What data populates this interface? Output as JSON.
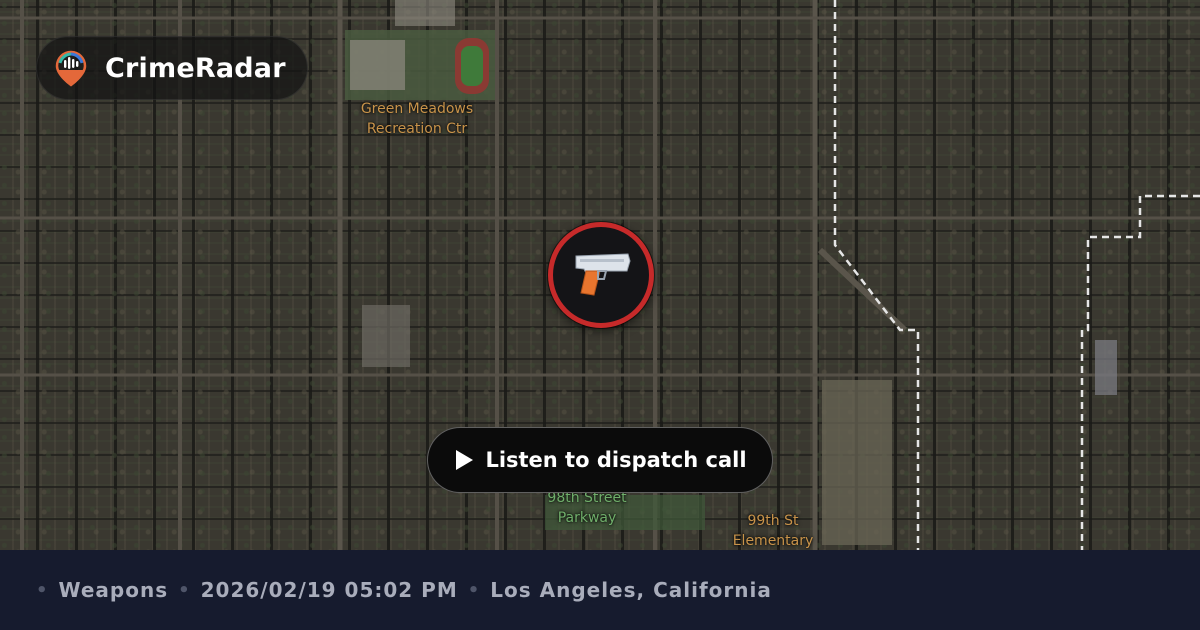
{
  "brand": {
    "name": "CrimeRadar",
    "logo_icon": "radar-pin-logo-icon"
  },
  "map": {
    "labels": [
      {
        "text": "Green Meadows\nRecreation Ctr",
        "color": "#c8934a"
      },
      {
        "text": "98th Street\nParkway",
        "color": "#6fae6a"
      },
      {
        "text": "99th St\nElementary",
        "color": "#c8934a"
      }
    ],
    "incident_marker": {
      "icon": "handgun-icon",
      "ring_color": "#c62a2a"
    }
  },
  "dispatch_button": {
    "label": "Listen to dispatch call",
    "icon": "play-icon"
  },
  "footer": {
    "separator": "•",
    "category": "Weapons",
    "datetime": "2026/02/19 05:02 PM",
    "location": "Los Angeles, California"
  }
}
